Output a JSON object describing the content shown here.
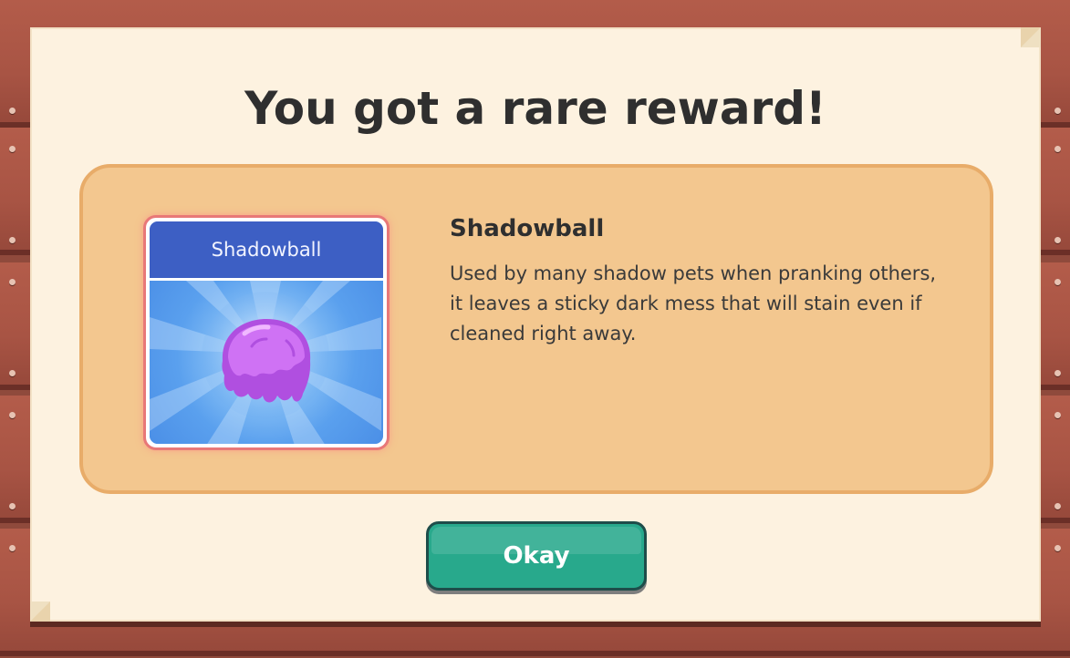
{
  "dialog": {
    "title": "You got a rare reward!"
  },
  "reward": {
    "card_label": "Shadowball",
    "name": "Shadowball",
    "description": "Used by many shadow pets when pranking others, it leaves a sticky dark mess that will stain even if cleaned right away.",
    "rarity_color": "#e87878",
    "icon": "purple-goo-ball-icon"
  },
  "actions": {
    "okay_label": "Okay"
  },
  "colors": {
    "wood": "#a85444",
    "parchment": "#fdf2e0",
    "reward_box": "#f3c78f",
    "button": "#28a98c",
    "card_header": "#3d5fc4"
  }
}
